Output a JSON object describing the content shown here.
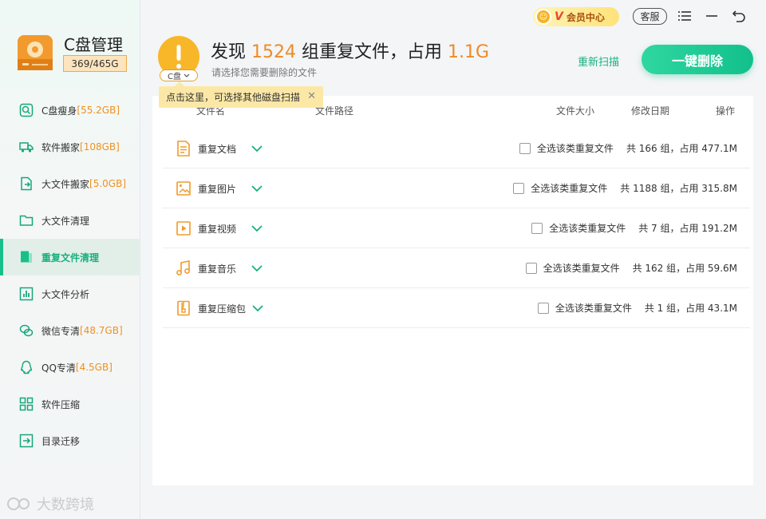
{
  "app": {
    "title": "C盘管理",
    "disk_usage": "369/465G"
  },
  "sidebar": {
    "items": [
      {
        "label": "C盘瘦身",
        "extra": "[55.2GB]",
        "icon": "broom-icon"
      },
      {
        "label": "软件搬家",
        "extra": "[108GB]",
        "icon": "truck-icon"
      },
      {
        "label": "大文件搬家",
        "extra": "[5.0GB]",
        "icon": "file-move-icon"
      },
      {
        "label": "大文件清理",
        "extra": "",
        "icon": "folder-icon"
      },
      {
        "label": "重复文件清理",
        "extra": "",
        "icon": "duplicate-icon",
        "active": true
      },
      {
        "label": "大文件分析",
        "extra": "",
        "icon": "chart-icon"
      },
      {
        "label": "微信专清",
        "extra": "[48.7GB]",
        "icon": "wechat-icon"
      },
      {
        "label": "QQ专清",
        "extra": "[4.5GB]",
        "icon": "qq-icon"
      },
      {
        "label": "软件压缩",
        "extra": "",
        "icon": "compress-icon"
      },
      {
        "label": "目录迁移",
        "extra": "",
        "icon": "migrate-icon"
      }
    ],
    "watermark": "大数跨境"
  },
  "topbar": {
    "vip_v": "V",
    "vip_label": "会员中心",
    "service": "客服"
  },
  "header": {
    "prefix": "发现 ",
    "group_count": "1524",
    "middle": " 组重复文件，占用 ",
    "size": "1.1G",
    "subtitle": "请选择您需要删除的文件",
    "drive": "C盘",
    "rescan": "重新扫描",
    "delete_all": "一键删除"
  },
  "tooltip": {
    "text": "点击这里，可选择其他磁盘扫描",
    "close": "✕"
  },
  "table": {
    "columns": {
      "name": "文件名",
      "path": "文件路径",
      "size": "文件大小",
      "date": "修改日期",
      "action": "操作"
    },
    "select_label": "全选该类重复文件",
    "rows": [
      {
        "name": "重复文档",
        "summary": "共 166 组，占用 477.1M",
        "icon": "document-icon"
      },
      {
        "name": "重复图片",
        "summary": "共 1188 组，占用 315.8M",
        "icon": "image-icon"
      },
      {
        "name": "重复视频",
        "summary": "共 7 组，占用 191.2M",
        "icon": "video-icon"
      },
      {
        "name": "重复音乐",
        "summary": "共 162 组，占用 59.6M",
        "icon": "music-icon"
      },
      {
        "name": "重复压缩包",
        "summary": "共 1 组，占用 43.1M",
        "icon": "zip-icon"
      }
    ]
  },
  "colors": {
    "accent": "#17c08a",
    "orange": "#f08a24",
    "warn": "#f8b629"
  }
}
